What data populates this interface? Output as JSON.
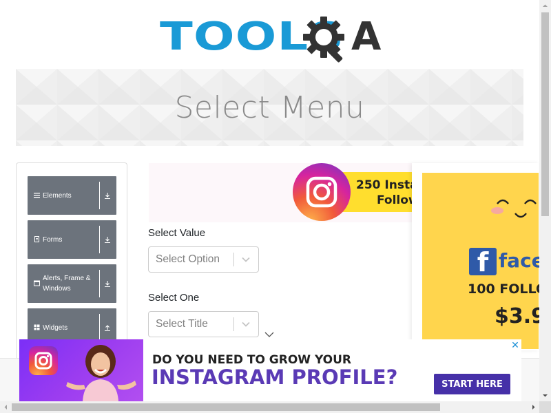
{
  "logo": {
    "tools": "TOOLS",
    "a": "A"
  },
  "page": {
    "title": "Select Menu"
  },
  "sidebar": {
    "items": [
      {
        "label": "Elements",
        "icon": "list-icon",
        "arrow": "download-icon"
      },
      {
        "label": "Forms",
        "icon": "document-icon",
        "arrow": "download-icon"
      },
      {
        "label": "Alerts, Frame & Windows",
        "icon": "window-icon",
        "arrow": "download-icon"
      },
      {
        "label": "Widgets",
        "icon": "grid-icon",
        "arrow": "upload-icon"
      }
    ]
  },
  "form": {
    "select_value": {
      "label": "Select Value",
      "placeholder": "Select Option"
    },
    "select_one": {
      "label": "Select One",
      "placeholder": "Select Title"
    }
  },
  "ads": {
    "instagram_top": {
      "line1": "250 Insta",
      "line2": "Follow"
    },
    "facebook": {
      "brand": "facel",
      "followers": "100 FOLLO",
      "price": "$3.9"
    },
    "bottom": {
      "line1": "DO YOU NEED TO GROW YOUR",
      "line2": "INSTAGRAM PROFILE?",
      "cta": "START HERE",
      "close": "✕"
    }
  },
  "colors": {
    "brand_blue": "#1a9ad6",
    "nav_gray": "#6c737c",
    "facebook_blue": "#2f5aa8",
    "ad_purple": "#4630a8"
  }
}
